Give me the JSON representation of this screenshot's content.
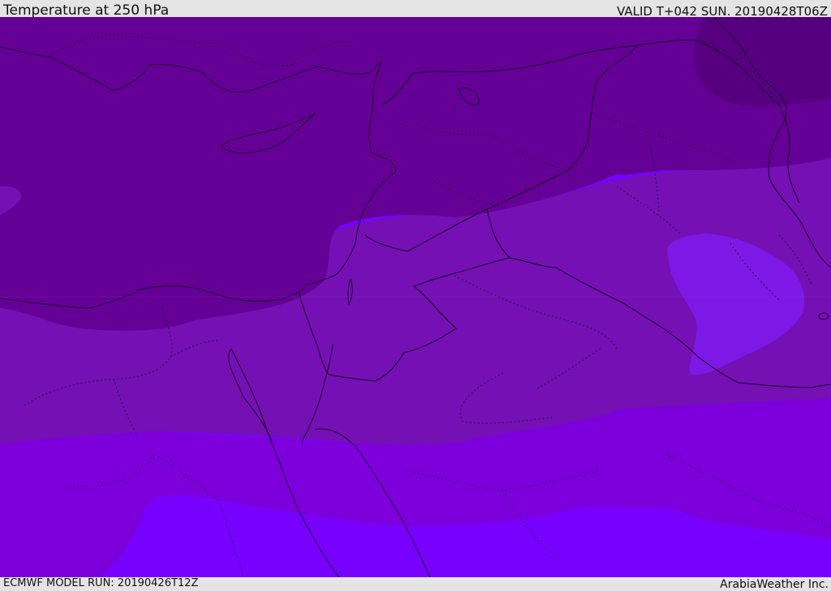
{
  "header": {
    "title": "Temperature at 250 hPa",
    "valid": "VALID T+042 SUN. 20190428T06Z"
  },
  "footer": {
    "model_run": "ECMWF MODEL RUN: 20190426T12Z",
    "brand": "ArabiaWeather Inc."
  },
  "map": {
    "field": "temperature",
    "level": "250 hPa",
    "colors": {
      "darkest": "#560080",
      "dark": "#650096",
      "mid": "#7410b4",
      "bright": "#7d00dc",
      "brightest": "#7800ff",
      "pocket": "#7d18e6"
    }
  }
}
